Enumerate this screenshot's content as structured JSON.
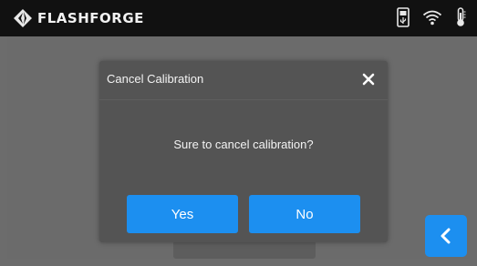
{
  "header": {
    "brand": "FLASHFORGE",
    "icons": [
      "flashforge-logo-icon",
      "usb-icon",
      "wifi-icon",
      "thermometer-icon"
    ]
  },
  "dialog": {
    "title": "Cancel Calibration",
    "message": "Sure to cancel calibration?",
    "yes_label": "Yes",
    "no_label": "No",
    "close_icon": "close-icon"
  },
  "nav": {
    "back_icon": "chevron-left-icon"
  },
  "colors": {
    "accent": "#1c8ff0",
    "topbar": "#111111",
    "dialog_bg": "#545454",
    "screen_bg": "#6c6c6c"
  }
}
